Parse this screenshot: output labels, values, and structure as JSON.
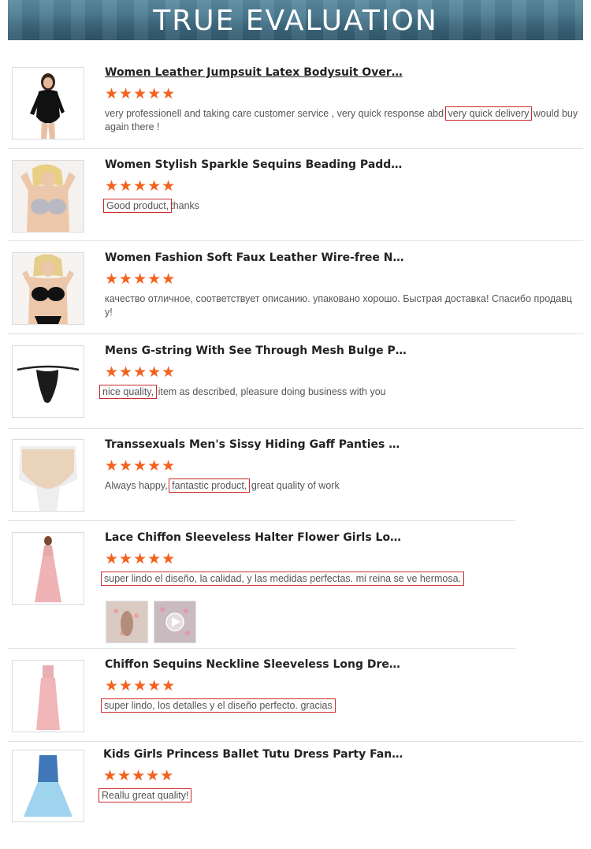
{
  "banner": {
    "title": "TRUE EVALUATION"
  },
  "reviews": [
    {
      "title": "Women Leather Jumpsuit Latex Bodysuit Over…",
      "stars": "★★★★★",
      "parts": [
        "very professionell and taking care customer service , very quick response abd ",
        "very quick delivery",
        " would buy again there !"
      ]
    },
    {
      "title": "Women Stylish Sparkle Sequins Beading Padd…",
      "stars": "★★★★★",
      "parts": [
        "",
        "Good product,",
        "thanks"
      ]
    },
    {
      "title": "Women Fashion Soft Faux Leather Wire-free N…",
      "stars": "★★★★★",
      "parts": [
        "качество отличное, соответствует описанию. упаковано хорошо. Быстрая доставка! Спасибо продавцу!",
        "",
        ""
      ]
    },
    {
      "title": "Mens G-string With See Through Mesh Bulge P…",
      "stars": "★★★★★",
      "parts": [
        "",
        "nice quality,",
        " item as described, pleasure doing business with you"
      ]
    },
    {
      "title": "Transsexuals Men's Sissy Hiding Gaff Panties …",
      "stars": "★★★★★",
      "parts": [
        "Always happy, ",
        "fantastic product,",
        " great quality of work"
      ]
    },
    {
      "title": "Lace Chiffon Sleeveless Halter Flower Girls Lo…",
      "stars": "★★★★★",
      "parts": [
        "",
        "super lindo el diseño, la calidad, y las medidas perfectas. mi reina se ve hermosa.",
        ""
      ]
    },
    {
      "title": "Chiffon Sequins Neckline Sleeveless Long Dre…",
      "stars": "★★★★★",
      "parts": [
        "",
        "super lindo, los detalles y el diseño perfecto. gracias",
        ""
      ]
    },
    {
      "title": "Kids Girls Princess Ballet Tutu Dress Party Fan…",
      "stars": "★★★★★",
      "parts": [
        "",
        "Reallu great quality!",
        ""
      ]
    }
  ],
  "colors": {
    "star": "#f4621f",
    "highlight_border": "#cc2a2a",
    "banner": "#4a7a90"
  }
}
